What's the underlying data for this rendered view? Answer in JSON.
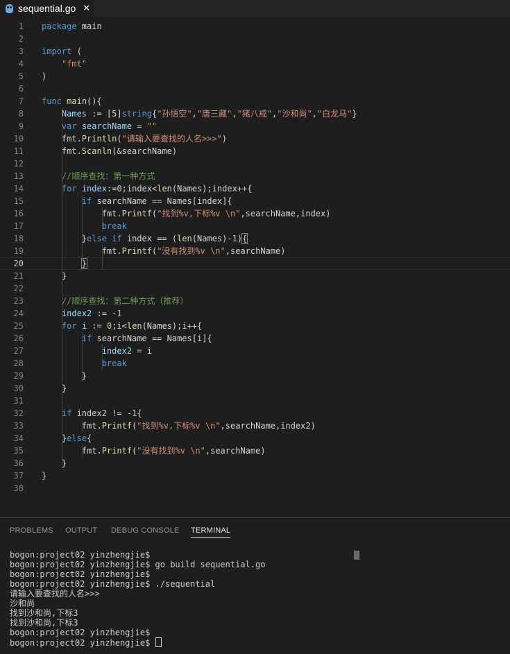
{
  "tab": {
    "filename": "sequential.go",
    "icon": "go-file-icon",
    "close_glyph": "✕"
  },
  "editor": {
    "active_line": 20,
    "lines": [
      {
        "n": "1",
        "segs": [
          [
            "k",
            "package"
          ],
          [
            "p",
            " main"
          ]
        ]
      },
      {
        "n": "2",
        "segs": []
      },
      {
        "n": "3",
        "segs": [
          [
            "k",
            "import"
          ],
          [
            "p",
            " ("
          ]
        ]
      },
      {
        "n": "4",
        "segs": [
          [
            "p",
            "    "
          ],
          [
            "s",
            "\"fmt\""
          ]
        ]
      },
      {
        "n": "5",
        "segs": [
          [
            "p",
            ")"
          ]
        ]
      },
      {
        "n": "6",
        "segs": []
      },
      {
        "n": "7",
        "segs": [
          [
            "k",
            "func"
          ],
          [
            "p",
            " "
          ],
          [
            "f",
            "main"
          ],
          [
            "p",
            "(){"
          ]
        ]
      },
      {
        "n": "8",
        "segs": [
          [
            "p",
            "    "
          ],
          [
            "v",
            "Names"
          ],
          [
            "p",
            " := [5]"
          ],
          [
            "k",
            "string"
          ],
          [
            "p",
            "{"
          ],
          [
            "s",
            "\"孙悟空\""
          ],
          [
            "p",
            ","
          ],
          [
            "s",
            "\"唐三藏\""
          ],
          [
            "p",
            ","
          ],
          [
            "s",
            "\"猪八戒\""
          ],
          [
            "p",
            ","
          ],
          [
            "s",
            "\"沙和尚\""
          ],
          [
            "p",
            ","
          ],
          [
            "s",
            "\"白龙马\""
          ],
          [
            "p",
            "}"
          ]
        ]
      },
      {
        "n": "9",
        "segs": [
          [
            "p",
            "    "
          ],
          [
            "k",
            "var"
          ],
          [
            "p",
            " "
          ],
          [
            "v",
            "searchName"
          ],
          [
            "p",
            " = "
          ],
          [
            "s",
            "\"\""
          ]
        ]
      },
      {
        "n": "10",
        "segs": [
          [
            "p",
            "    fmt."
          ],
          [
            "f",
            "Println"
          ],
          [
            "p",
            "("
          ],
          [
            "s",
            "\"请输入要查找的人名>>>\""
          ],
          [
            "p",
            ")"
          ]
        ]
      },
      {
        "n": "11",
        "segs": [
          [
            "p",
            "    fmt."
          ],
          [
            "f",
            "Scanln"
          ],
          [
            "p",
            "(&searchName)"
          ]
        ]
      },
      {
        "n": "12",
        "segs": []
      },
      {
        "n": "13",
        "segs": [
          [
            "p",
            "    "
          ],
          [
            "c",
            "//顺序查找：第一种方式"
          ]
        ]
      },
      {
        "n": "14",
        "segs": [
          [
            "p",
            "    "
          ],
          [
            "k",
            "for"
          ],
          [
            "p",
            " "
          ],
          [
            "v",
            "index"
          ],
          [
            "p",
            ":="
          ],
          [
            "n",
            "0"
          ],
          [
            "p",
            ";index<"
          ],
          [
            "f",
            "len"
          ],
          [
            "p",
            "(Names);index++{"
          ]
        ]
      },
      {
        "n": "15",
        "segs": [
          [
            "p",
            "        "
          ],
          [
            "k",
            "if"
          ],
          [
            "p",
            " searchName == Names[index]{"
          ]
        ]
      },
      {
        "n": "16",
        "segs": [
          [
            "p",
            "            fmt."
          ],
          [
            "f",
            "Printf"
          ],
          [
            "p",
            "("
          ],
          [
            "s",
            "\"找到%v,下标%v \\n\""
          ],
          [
            "p",
            ",searchName,index)"
          ]
        ]
      },
      {
        "n": "17",
        "segs": [
          [
            "p",
            "            "
          ],
          [
            "k",
            "break"
          ]
        ]
      },
      {
        "n": "18",
        "segs": [
          [
            "p",
            "        }"
          ],
          [
            "k",
            "else"
          ],
          [
            "p",
            " "
          ],
          [
            "k",
            "if"
          ],
          [
            "p",
            " index == ("
          ],
          [
            "f",
            "len"
          ],
          [
            "p",
            "(Names)-"
          ],
          [
            "n",
            "1"
          ],
          [
            "p",
            ")"
          ],
          [
            "b",
            "{"
          ]
        ]
      },
      {
        "n": "19",
        "segs": [
          [
            "p",
            "            fmt."
          ],
          [
            "f",
            "Printf"
          ],
          [
            "p",
            "("
          ],
          [
            "s",
            "\"没有找到%v \\n\""
          ],
          [
            "p",
            ",searchName)"
          ]
        ]
      },
      {
        "n": "20",
        "segs": [
          [
            "p",
            "        "
          ],
          [
            "b",
            "}"
          ]
        ]
      },
      {
        "n": "21",
        "segs": [
          [
            "p",
            "    }"
          ]
        ]
      },
      {
        "n": "22",
        "segs": []
      },
      {
        "n": "23",
        "segs": [
          [
            "p",
            "    "
          ],
          [
            "c",
            "//顺序查找：第二种方式（推荐）"
          ]
        ]
      },
      {
        "n": "24",
        "segs": [
          [
            "p",
            "    "
          ],
          [
            "v",
            "index2"
          ],
          [
            "p",
            " := -"
          ],
          [
            "n",
            "1"
          ]
        ]
      },
      {
        "n": "25",
        "segs": [
          [
            "p",
            "    "
          ],
          [
            "k",
            "for"
          ],
          [
            "p",
            " "
          ],
          [
            "v",
            "i"
          ],
          [
            "p",
            " := "
          ],
          [
            "n",
            "0"
          ],
          [
            "p",
            ";i<"
          ],
          [
            "f",
            "len"
          ],
          [
            "p",
            "(Names);i++{"
          ]
        ]
      },
      {
        "n": "26",
        "segs": [
          [
            "p",
            "        "
          ],
          [
            "k",
            "if"
          ],
          [
            "p",
            " searchName == Names[i]{"
          ]
        ]
      },
      {
        "n": "27",
        "segs": [
          [
            "p",
            "            "
          ],
          [
            "v",
            "index2"
          ],
          [
            "p",
            " = i"
          ]
        ]
      },
      {
        "n": "28",
        "segs": [
          [
            "p",
            "            "
          ],
          [
            "k",
            "break"
          ]
        ]
      },
      {
        "n": "29",
        "segs": [
          [
            "p",
            "        }"
          ]
        ]
      },
      {
        "n": "30",
        "segs": [
          [
            "p",
            "    }"
          ]
        ]
      },
      {
        "n": "31",
        "segs": []
      },
      {
        "n": "32",
        "segs": [
          [
            "p",
            "    "
          ],
          [
            "k",
            "if"
          ],
          [
            "p",
            " index2 != -"
          ],
          [
            "n",
            "1"
          ],
          [
            "p",
            "{"
          ]
        ]
      },
      {
        "n": "33",
        "segs": [
          [
            "p",
            "        fmt."
          ],
          [
            "f",
            "Printf"
          ],
          [
            "p",
            "("
          ],
          [
            "s",
            "\"找到%v,下标%v \\n\""
          ],
          [
            "p",
            ",searchName,index2)"
          ]
        ]
      },
      {
        "n": "34",
        "segs": [
          [
            "p",
            "    }"
          ],
          [
            "k",
            "else"
          ],
          [
            "p",
            "{"
          ]
        ]
      },
      {
        "n": "35",
        "segs": [
          [
            "p",
            "        fmt."
          ],
          [
            "f",
            "Printf"
          ],
          [
            "p",
            "("
          ],
          [
            "s",
            "\"没有找到%v \\n\""
          ],
          [
            "p",
            ",searchName)"
          ]
        ]
      },
      {
        "n": "36",
        "segs": [
          [
            "p",
            "    }"
          ]
        ]
      },
      {
        "n": "37",
        "segs": [
          [
            "p",
            "}"
          ]
        ]
      },
      {
        "n": "38",
        "segs": []
      }
    ]
  },
  "panel": {
    "tabs": [
      {
        "label": "PROBLEMS",
        "active": false
      },
      {
        "label": "OUTPUT",
        "active": false
      },
      {
        "label": "DEBUG CONSOLE",
        "active": false
      },
      {
        "label": "TERMINAL",
        "active": true
      }
    ],
    "terminal_lines": [
      "bogon:project02 yinzhengjie$",
      "bogon:project02 yinzhengjie$ go build sequential.go",
      "bogon:project02 yinzhengjie$",
      "bogon:project02 yinzhengjie$ ./sequential",
      "请输入要查找的人名>>>",
      "沙和尚",
      "找到沙和尚,下标3",
      "找到沙和尚,下标3",
      "bogon:project02 yinzhengjie$",
      "bogon:project02 yinzhengjie$ "
    ]
  },
  "colors": {
    "background": "#1e1e1e",
    "keyword": "#569cd6",
    "string": "#ce9178",
    "function": "#dcdcaa",
    "variable": "#9cdcfe",
    "comment": "#6a9955",
    "number": "#b5cea8"
  }
}
